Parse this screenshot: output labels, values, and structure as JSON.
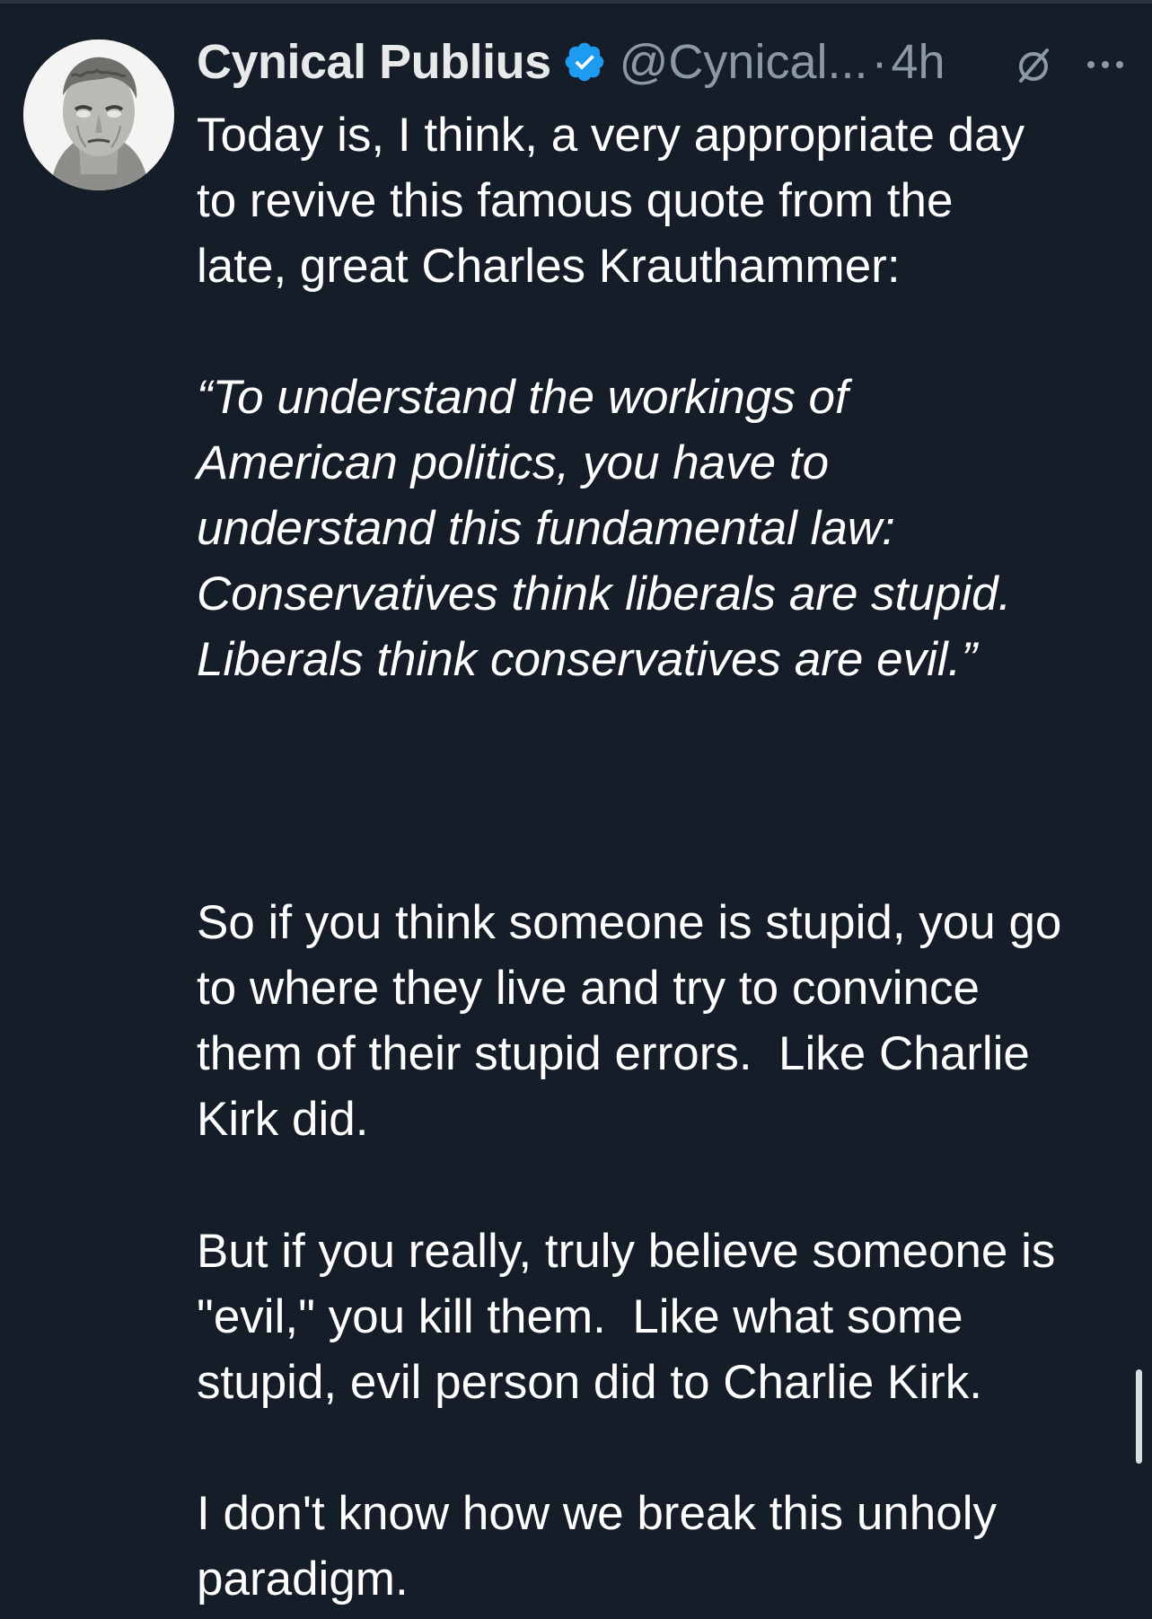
{
  "tweet": {
    "display_name": "Cynical Publius",
    "handle": "@Cynical...",
    "separator_dot": "·",
    "time": "4h",
    "body_intro": "Today is, I think, a very appropriate day\nto revive this famous quote from the\nlate, great Charles Krauthammer:",
    "quote": "“To understand the workings of\nAmerican politics, you have to\nunderstand this fundamental law:\nConservatives think liberals are stupid.\nLiberals think conservatives are evil.”",
    "separator_line": "______________________________________",
    "paragraph_1": "So if you think someone is stupid, you go\nto where they live and try to convince\nthem of their stupid errors.  Like Charlie\nKirk did.",
    "paragraph_2": "But if you really, truly believe someone is\n\"evil,\" you kill them.  Like what some\nstupid, evil person did to Charlie Kirk.",
    "paragraph_3": "I don't know how we break this unholy\nparadigm."
  },
  "icons": {
    "avatar": "avatar-bust-image",
    "verified": "verified-badge-icon",
    "muted": "muted-conversation-icon",
    "more": "more-options-icon"
  },
  "colors": {
    "background": "#151d28",
    "text": "#ffffff",
    "secondary_text": "#8b98a5",
    "verified_blue": "#1d9bf0"
  }
}
